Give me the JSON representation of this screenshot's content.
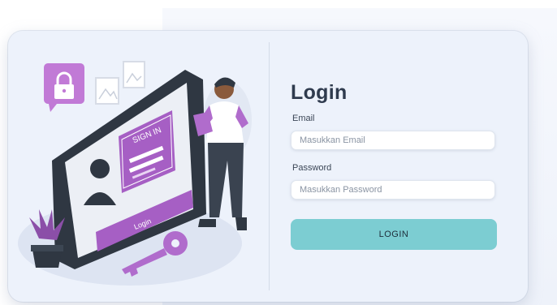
{
  "form": {
    "title": "Login",
    "email_label": "Email",
    "email_placeholder": "Masukkan Email",
    "password_label": "Password",
    "password_placeholder": "Masukkan Password",
    "login_button": "LOGIN"
  },
  "illustration": {
    "sign_in_text": "SIGN IN",
    "tablet_button_text": "Login"
  },
  "colors": {
    "accent_button": "#7ccdd2",
    "illustration_purple": "#a65fc4",
    "card_background": "#edf2fb"
  }
}
